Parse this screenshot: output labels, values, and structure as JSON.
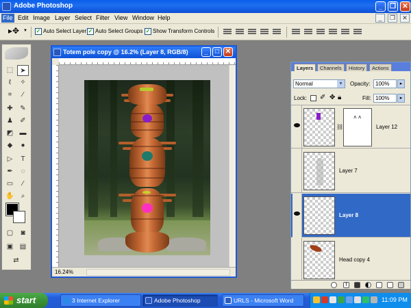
{
  "app": {
    "title": "Adobe Photoshop"
  },
  "menu": [
    "File",
    "Edit",
    "Image",
    "Layer",
    "Select",
    "Filter",
    "View",
    "Window",
    "Help"
  ],
  "options": {
    "auto_select_layer": "Auto Select Layer",
    "auto_select_groups": "Auto Select Groups",
    "show_transform": "Show Transform Controls"
  },
  "document": {
    "title": "Totem pole copy @ 16.2% (Layer 8, RGB/8)",
    "zoom": "16.24%"
  },
  "layers_panel": {
    "tabs": [
      "Layers",
      "Channels",
      "History",
      "Actions"
    ],
    "blend_mode": "Normal",
    "opacity_label": "Opacity:",
    "opacity": "100%",
    "lock_label": "Lock:",
    "fill_label": "Fill:",
    "fill": "100%",
    "layers": [
      {
        "name": "Layer 12",
        "visible": true,
        "active": false
      },
      {
        "name": "Layer 7",
        "visible": false,
        "active": false
      },
      {
        "name": "Layer 8",
        "visible": true,
        "active": true
      },
      {
        "name": "Head copy 4",
        "visible": false,
        "active": false
      }
    ]
  },
  "taskbar": {
    "start": "start",
    "items": [
      "3 Internet Explorer",
      "Adobe Photoshop",
      "URLS - Microsoft Word"
    ],
    "clock": "11:09 PM"
  },
  "colors": {
    "accent": "#316ac5",
    "active_layer": "#3169c6",
    "taskbar": "#245edc",
    "start": "#3b9138"
  }
}
